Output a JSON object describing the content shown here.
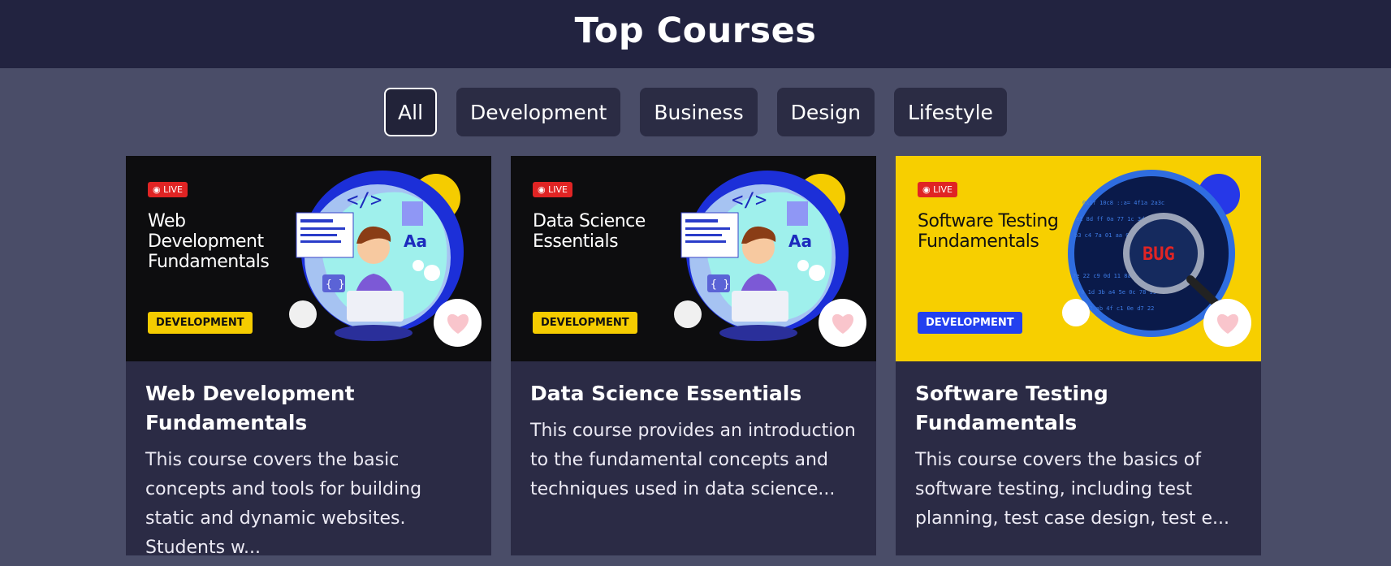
{
  "header": {
    "title": "Top Courses"
  },
  "filters": [
    {
      "label": "All",
      "active": true
    },
    {
      "label": "Development",
      "active": false
    },
    {
      "label": "Business",
      "active": false
    },
    {
      "label": "Design",
      "active": false
    },
    {
      "label": "Lifestyle",
      "active": false
    }
  ],
  "courses": [
    {
      "badge": "LIVE",
      "thumb_title": "Web Development Fundamentals",
      "tag": "DEVELOPMENT",
      "title": "Web Development Fundamentals",
      "description": "This course covers the basic concepts and tools for building static and dynamic websites. Students w...",
      "theme": "dark"
    },
    {
      "badge": "LIVE",
      "thumb_title": "Data Science Essentials",
      "tag": "DEVELOPMENT",
      "title": "Data Science Essentials",
      "description": "This course provides an introduction to the fundamental concepts and techniques used in data science...",
      "theme": "dark"
    },
    {
      "badge": "LIVE",
      "thumb_title": "Software Testing Fundamentals",
      "tag": "DEVELOPMENT",
      "title": "Software Testing Fundamentals",
      "description": "This course covers the basics of software testing, including test planning, test case design, test e...",
      "theme": "yellow",
      "art_text": "BUG"
    }
  ],
  "colors": {
    "page_bg": "#4a4d68",
    "header_bg": "#222340",
    "card_bg": "#2b2b45",
    "live_red": "#e02424",
    "tag_yellow": "#f5cc00",
    "tag_blue": "#2340ef",
    "heart_pink": "#f9c5cc"
  }
}
